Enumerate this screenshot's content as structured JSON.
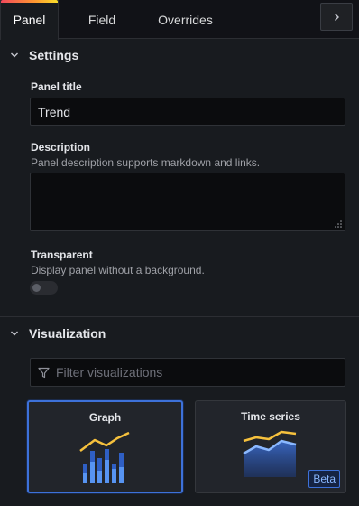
{
  "tabs": {
    "panel": "Panel",
    "field": "Field",
    "overrides": "Overrides"
  },
  "collapse_icon": "chevron-right-icon",
  "settings": {
    "title": "Settings",
    "panel_title": {
      "label": "Panel title",
      "value": "Trend"
    },
    "description": {
      "label": "Description",
      "help": "Panel description supports markdown and links.",
      "value": ""
    },
    "transparent": {
      "label": "Transparent",
      "help": "Display panel without a background.",
      "enabled": false
    }
  },
  "visualization": {
    "title": "Visualization",
    "filter_placeholder": "Filter visualizations",
    "filter_icon": "filter-icon",
    "cards": [
      {
        "name": "Graph",
        "selected": true,
        "icon": "graph-thumbnail"
      },
      {
        "name": "Time series",
        "selected": false,
        "badge": "Beta",
        "icon": "time-series-thumbnail"
      }
    ]
  },
  "colors": {
    "accent_blue": "#3d71d9",
    "tab_gradient": [
      "#f2495c",
      "#ff9830",
      "#fade2a"
    ],
    "series_yellow": "#f6c13d",
    "series_blue": "#5794f2"
  }
}
